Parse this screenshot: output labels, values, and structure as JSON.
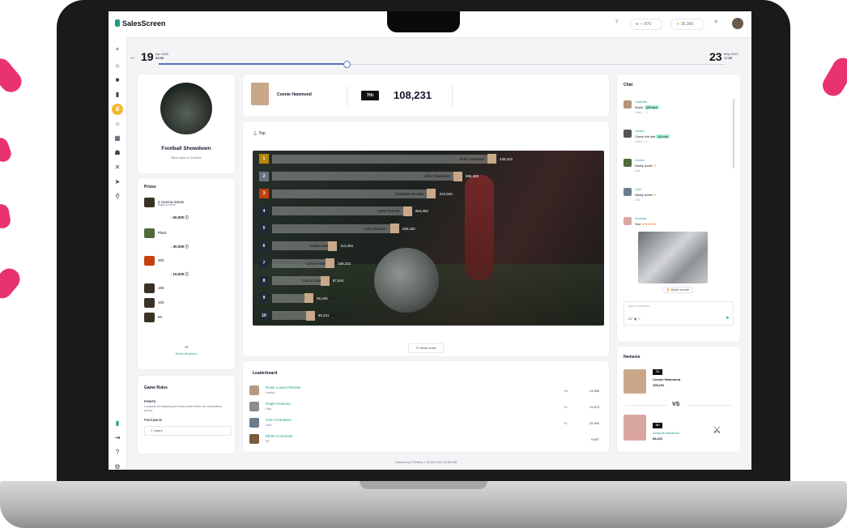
{
  "app": {
    "name": "SalesScreen"
  },
  "topbar": {
    "pill1": "870",
    "pill2": "36,390"
  },
  "timeline": {
    "start_day": "19",
    "start_month": "Apr 2022",
    "start_time": "09:00",
    "end_day": "23",
    "end_month": "May 2022",
    "end_time": "17:00",
    "progress": 0.33
  },
  "competition": {
    "title": "Football Showdown",
    "subtitle": "Best case to Commit"
  },
  "prizes": {
    "heading": "Prizes",
    "items": [
      {
        "label": "2 cinema tickets",
        "sub": "Enjoy a movie"
      },
      {
        "label": "Plant"
      },
      {
        "label": "300"
      },
      {
        "label": "150"
      },
      {
        "label": "100"
      },
      {
        "label": "50"
      }
    ],
    "thresholds": [
      "50,000",
      "30,000",
      "10,000"
    ],
    "more_count": "+5",
    "show_all": "Show all prizes"
  },
  "rules": {
    "heading": "Game Rules",
    "type": "POINTS",
    "description": "Compete on obtaining the most points within the competition period.",
    "participants_label": "Participants",
    "participants_value": "Users"
  },
  "me": {
    "name": "Connie Hammond",
    "rank": "7th",
    "score": "108,231"
  },
  "top_section": {
    "label": "Top",
    "show_chart": "Show chart"
  },
  "chart_data": {
    "type": "bar",
    "title": "Top",
    "categories": [
      "Ruby Hampton",
      "John Chambers",
      "Charlotte Morales",
      "Anita Thomas",
      "Carl Simmons",
      "Jordan Santana",
      "Connie Hammond",
      "Carlos Oliver Adams",
      "Louise Fletcher",
      "Leida Blackwell"
    ],
    "ranks": [
      "1",
      "2",
      "3",
      "4",
      "5",
      "6",
      "7",
      "8",
      "9",
      "10"
    ],
    "values": [
      435331,
      366482,
      313344,
      264452,
      238182,
      113481,
      108231,
      97542,
      65435,
      68231
    ],
    "value_labels": [
      "435,331",
      "366,482",
      "313,344",
      "264,452",
      "238,182",
      "113,481",
      "108,231",
      "97,542",
      "65,435",
      "68,231"
    ],
    "rank_colors": [
      "#b8860b",
      "#6b7280",
      "#c2410c",
      "#1f2937",
      "#1f2937",
      "#1f2937",
      "#1f2937",
      "#1f2937",
      "#1f2937",
      "#1f2937"
    ]
  },
  "leaderboard": {
    "heading": "Leaderboard",
    "rows": [
      {
        "name": "Rosie Louise Fletcher",
        "sub": "London",
        "change": "+3",
        "points": "13,966"
      },
      {
        "name": "Ralph Freeman",
        "sub": "Oslo",
        "change": "+1",
        "points": "11,875"
      },
      {
        "name": "John Chambers",
        "sub": "Oslo",
        "change": "+1",
        "points": "10,969"
      },
      {
        "name": "Ethan Commons",
        "sub": "NY",
        "change": "",
        "points": "9,667"
      }
    ]
  },
  "footer": {
    "text": "Created by Timothy • 15.04.2022 10:55 AM"
  },
  "chat": {
    "heading": "Chat",
    "messages": [
      {
        "name": "Charlotte",
        "text": "Woot!"
      },
      {
        "name": "Jordan",
        "text": "Check the last"
      },
      {
        "name": "Connie",
        "text": "Nicely done!"
      },
      {
        "name": "John",
        "text": "Nicely done!"
      },
      {
        "name": "Amanda",
        "text": "Yes!"
      }
    ],
    "reaction": "Movie smooth",
    "input_placeholder": "Type a comment"
  },
  "nemesis": {
    "heading": "Nemesis",
    "me": {
      "rank": "7th",
      "name": "Connie Hammond",
      "score": "108,231"
    },
    "vs": "VS",
    "rival": {
      "rank": "6th",
      "name": "Amanda Blackwell",
      "score": "68,231"
    }
  }
}
